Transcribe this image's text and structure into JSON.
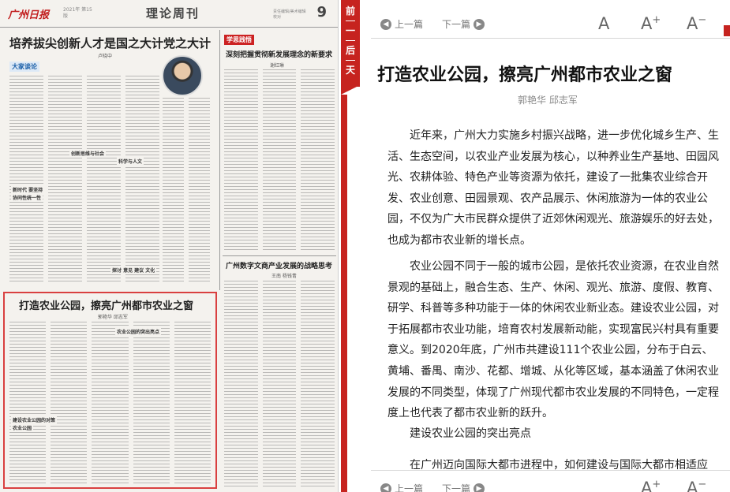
{
  "paper": {
    "logo": "广州日报",
    "masthead_meta": "2021年 第15版",
    "section_title": "理论周刊",
    "page_number": "9",
    "masthead_right": "责任编辑/美术编辑 校对",
    "lead_headline": "培养拔尖创新人才是国之大计党之大计",
    "lead_byline": "卢晓中",
    "column_badge": "大家谈论",
    "side_badge": "学思践悟",
    "side_headline": "深刻把握贯彻新发展理念的新要求",
    "side_byline": "谢红琳",
    "side_headline2": "广州数字文商产业发展的战略思考",
    "side_byline2": "王南 杨钱青",
    "highlight_headline": "打造农业公园，擦亮广州都市农业之窗",
    "highlight_byline": "郭艳华 邱志军",
    "subheads": [
      "农业公园的突出亮点",
      "新时代 要坚持",
      "协同性统一性",
      "创新思维与社会",
      "科学与人文",
      "探讨 意见 建议 文化",
      "建设农业公园的对策",
      "农业公园"
    ]
  },
  "day_tab": {
    "top_chars": [
      "前",
      "一",
      "天"
    ],
    "bottom_chars": [
      "后",
      "一",
      "天"
    ]
  },
  "toolbar": {
    "prev_label": "上一篇",
    "next_label": "下一篇",
    "font_default": "A",
    "font_larger": "A",
    "font_larger_sign": "+",
    "font_smaller": "A",
    "font_smaller_sign": "−"
  },
  "article": {
    "title": "打造农业公园，擦亮广州都市农业之窗",
    "author": "郭艳华 邱志军",
    "paragraphs": [
      "近年来，广州大力实施乡村振兴战略，进一步优化城乡生产、生活、生态空间，以农业产业发展为核心，以种养业生产基地、田园风光、农耕体验、特色产业等资源为依托，建设了一批集农业综合开发、农业创意、田园景观、农产品展示、休闲旅游为一体的农业公园，不仅为广大市民群众提供了近郊休闲观光、旅游娱乐的好去处，也成为都市农业新的增长点。",
      "农业公园不同于一般的城市公园，是依托农业资源，在农业自然景观的基础上，融合生态、生产、休闲、观光、旅游、度假、教育、研学、科普等多种功能于一体的休闲农业新业态。建设农业公园，对于拓展都市农业功能，培育农村发展新动能，实现富民兴村具有重要意义。到2020年底，广州市共建设111个农业公园，分布于白云、黄埔、番禺、南沙、花都、增城、从化等区域，基本涵盖了休闲农业发展的不同类型，体现了广州现代都市农业发展的不同特色，一定程度上也代表了都市农业新的跃升。",
      "建设农业公园的突出亮点",
      "在广州迈向国际大都市进程中，如何建设与国际大都市相适应"
    ]
  },
  "colors": {
    "accent_red": "#c6231f",
    "highlight_border": "#d94040",
    "paper_bg": "#f4f2ee"
  },
  "icons": {
    "prev": "left-arrow-circle-icon",
    "next": "right-arrow-circle-icon"
  }
}
